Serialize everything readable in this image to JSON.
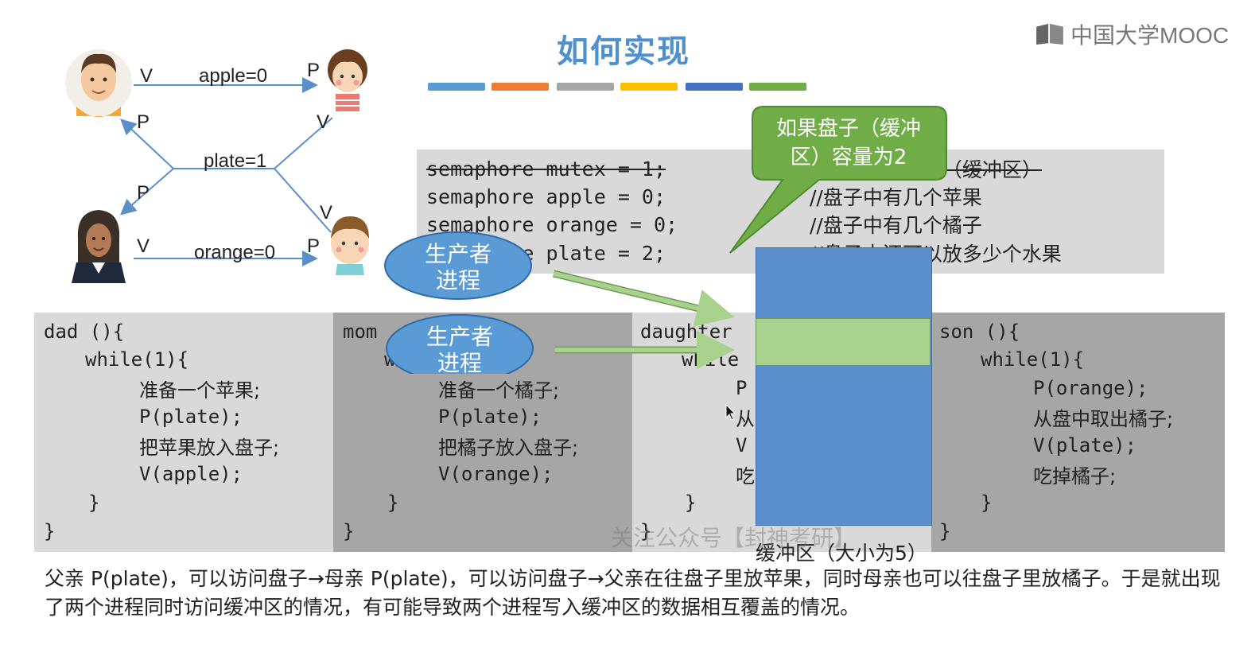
{
  "title": "如何实现",
  "logo": {
    "text": "中国大学MOOC",
    "icon": "mooc-book-icon"
  },
  "color_bars": [
    "#5b9bd5",
    "#ed7d31",
    "#a5a5a5",
    "#ffc000",
    "#4472c4",
    "#70ad47"
  ],
  "diagram": {
    "apple": "apple=0",
    "plate": "plate=1",
    "orange": "orange=0",
    "v_top": "V",
    "p_top": "P",
    "p_left_up": "P",
    "v_right_up": "V",
    "p_left_down": "P",
    "v_right_down": "V",
    "v_bottom": "V",
    "p_bottom": "P",
    "people": [
      "dad-avatar",
      "daughter-avatar",
      "mom-avatar",
      "son-avatar"
    ]
  },
  "semaphores": [
    {
      "code": "semaphore mutex = 1;",
      "comment": "//互斥访问盘子（缓冲区）",
      "strikethrough": true
    },
    {
      "code": "semaphore apple = 0;",
      "comment": "//盘子中有几个苹果"
    },
    {
      "code": "semaphore orange = 0;",
      "comment": "//盘子中有几个橘子"
    },
    {
      "code": "semaphore plate = 2;",
      "comment": "//盘子中还可以放多少个水果"
    }
  ],
  "callout": {
    "line1": "如果盘子（缓冲",
    "line2": "区）容量为2"
  },
  "producer_label": {
    "line1": "生产者",
    "line2": "进程"
  },
  "code_panels": {
    "dad": {
      "header": "dad (){",
      "while": "while(1){",
      "body": [
        "准备一个苹果;",
        "P(plate);",
        "把苹果放入盘子;",
        "V(apple);"
      ],
      "close_inner": "}",
      "close_outer": "}"
    },
    "mom": {
      "header": "mom",
      "while": "w",
      "body": [
        "准备一个橘子;",
        "P(plate);",
        "把橘子放入盘子;",
        "V(orange);"
      ],
      "close_inner": "}",
      "close_outer": "}"
    },
    "daughter": {
      "header": "daughter",
      "while": "while",
      "body": [
        "P",
        "从",
        "V",
        "吃"
      ],
      "close_inner": "}",
      "close_outer": "}"
    },
    "son": {
      "header": "son (){",
      "while": "while(1){",
      "body": [
        "P(orange);",
        "从盘中取出橘子;",
        "V(plate);",
        "吃掉橘子;"
      ],
      "close_inner": "}",
      "close_outer": "}"
    }
  },
  "buffer_caption": "缓冲区（大小为5）",
  "watermark": "关注公众号【封神考研】",
  "bottom_text": "父亲 P(plate)，可以访问盘子→母亲 P(plate)，可以访问盘子→父亲在往盘子里放苹果，同时母亲也可以往盘子里放橘子。于是就出现了两个进程同时访问缓冲区的情况，有可能导致两个进程写入缓冲区的数据相互覆盖的情况。"
}
